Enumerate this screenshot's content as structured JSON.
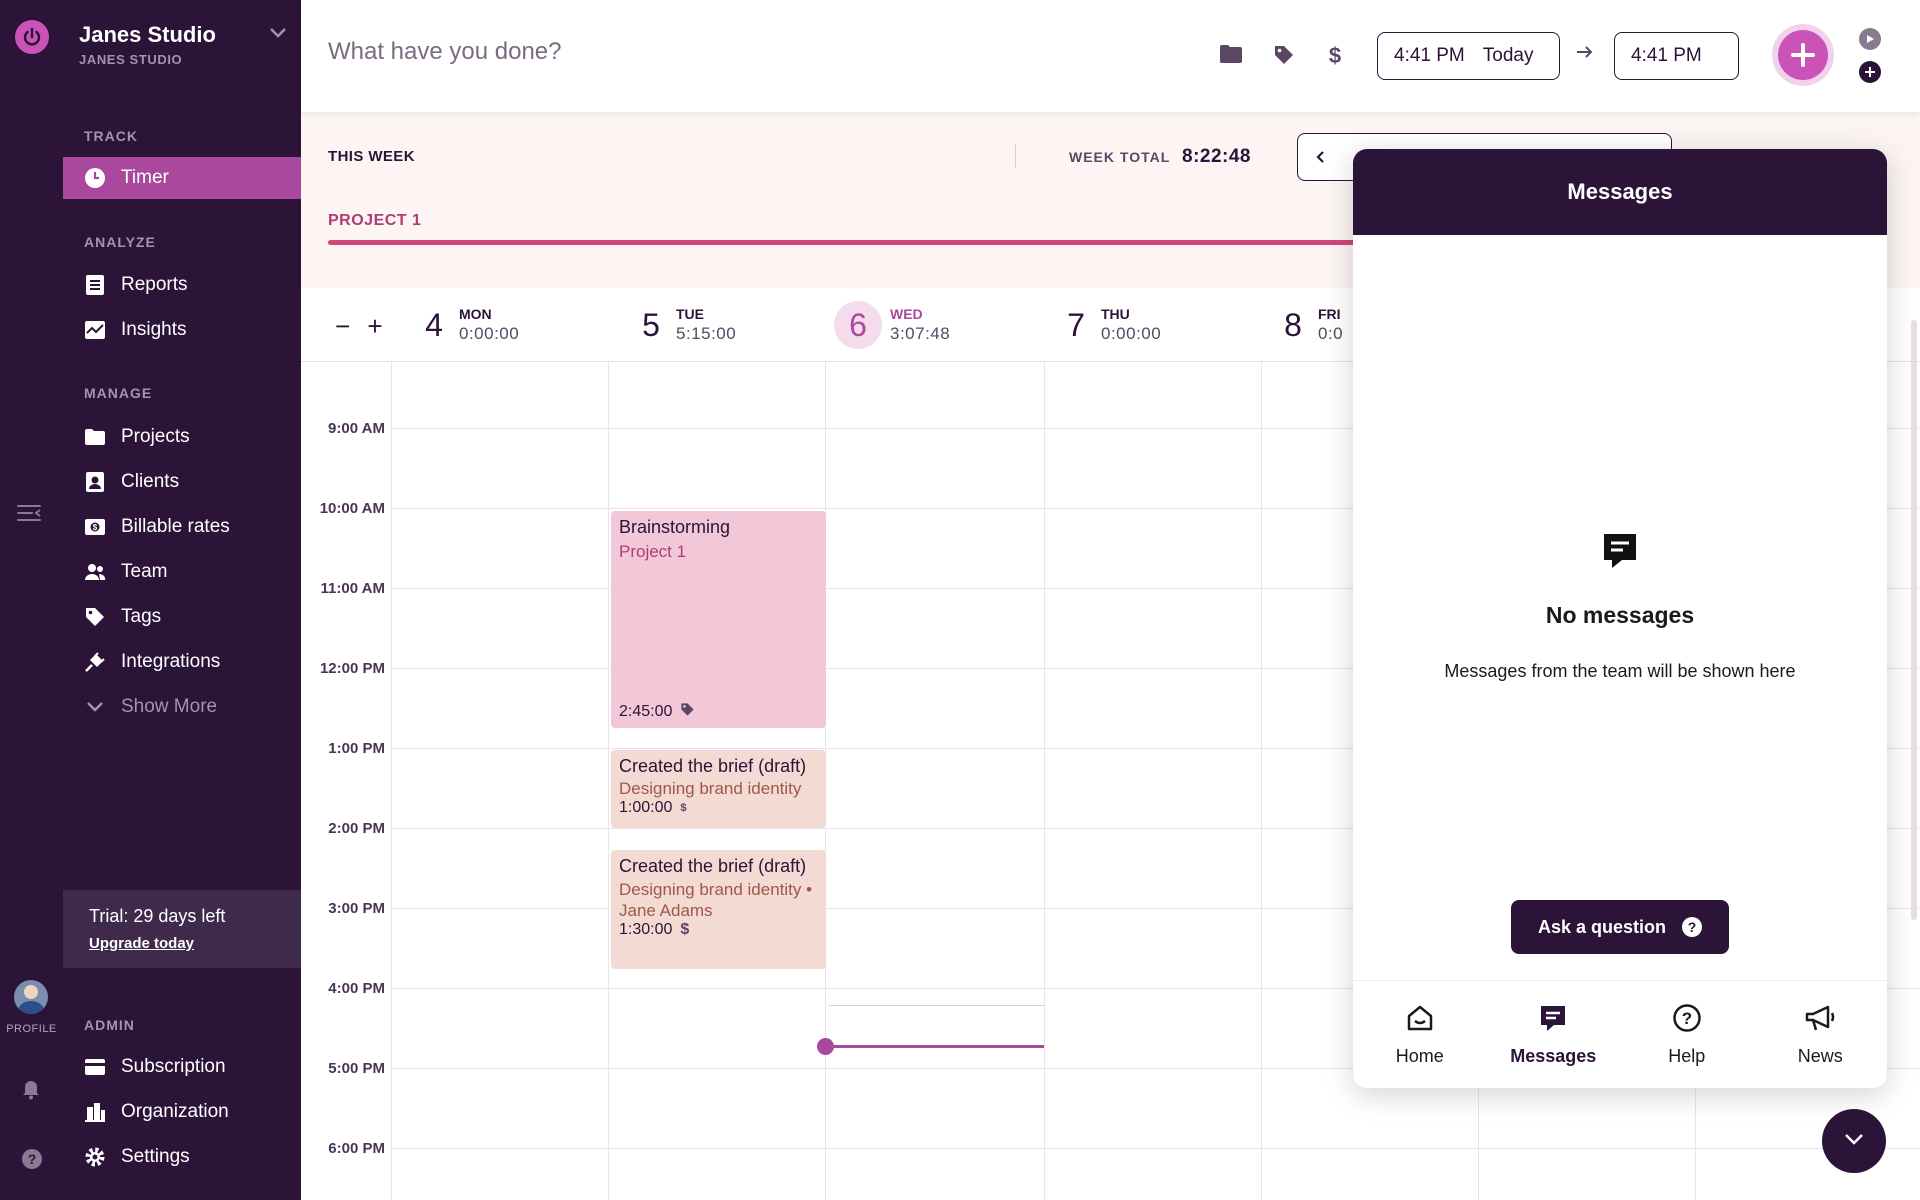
{
  "workspace": {
    "name": "Janes Studio",
    "subtitle": "JANES STUDIO"
  },
  "sidebar": {
    "sections": {
      "track": "TRACK",
      "analyze": "ANALYZE",
      "manage": "MANAGE",
      "admin": "ADMIN"
    },
    "items": {
      "timer": "Timer",
      "reports": "Reports",
      "insights": "Insights",
      "projects": "Projects",
      "clients": "Clients",
      "billable_rates": "Billable rates",
      "team": "Team",
      "tags": "Tags",
      "integrations": "Integrations",
      "show_more": "Show More",
      "subscription": "Subscription",
      "organization": "Organization",
      "settings": "Settings"
    },
    "trial": {
      "text": "Trial: 29 days left",
      "link": "Upgrade today"
    }
  },
  "rail": {
    "profile_label": "PROFILE"
  },
  "timer_bar": {
    "description_placeholder": "What have you done?",
    "start_time": "4:41 PM",
    "start_day": "Today",
    "end_time": "4:41 PM"
  },
  "week": {
    "this_week": "THIS WEEK",
    "week_total_label": "WEEK TOTAL",
    "week_total": "8:22:48",
    "project_label": "PROJECT 1"
  },
  "days": [
    {
      "num": "4",
      "name": "MON",
      "total": "0:00:00"
    },
    {
      "num": "5",
      "name": "TUE",
      "total": "5:15:00"
    },
    {
      "num": "6",
      "name": "WED",
      "total": "3:07:48"
    },
    {
      "num": "7",
      "name": "THU",
      "total": "0:00:00"
    },
    {
      "num": "8",
      "name": "FRI",
      "total": "0:0"
    }
  ],
  "hours": [
    "9:00 AM",
    "10:00 AM",
    "11:00 AM",
    "12:00 PM",
    "1:00 PM",
    "2:00 PM",
    "3:00 PM",
    "4:00 PM",
    "5:00 PM",
    "6:00 PM"
  ],
  "entries": [
    {
      "title": "Brainstorming",
      "project": "Project 1",
      "duration": "2:45:00"
    },
    {
      "title": "Created the brief (draft)",
      "project": "Designing brand identity",
      "duration": "1:00:00"
    },
    {
      "title": "Created the brief (draft)",
      "project": "Designing brand identity • Jane Adams",
      "duration": "1:30:00"
    }
  ],
  "messages": {
    "title": "Messages",
    "empty_title": "No messages",
    "empty_subtitle": "Messages from the team will be shown here",
    "ask_button": "Ask a question",
    "tabs": {
      "home": "Home",
      "messages": "Messages",
      "help": "Help",
      "news": "News"
    }
  },
  "colors": {
    "sidebar_bg": "#2c1338",
    "accent": "#cb53b8",
    "active_nav": "#a9489c",
    "project": "#d1477a"
  }
}
